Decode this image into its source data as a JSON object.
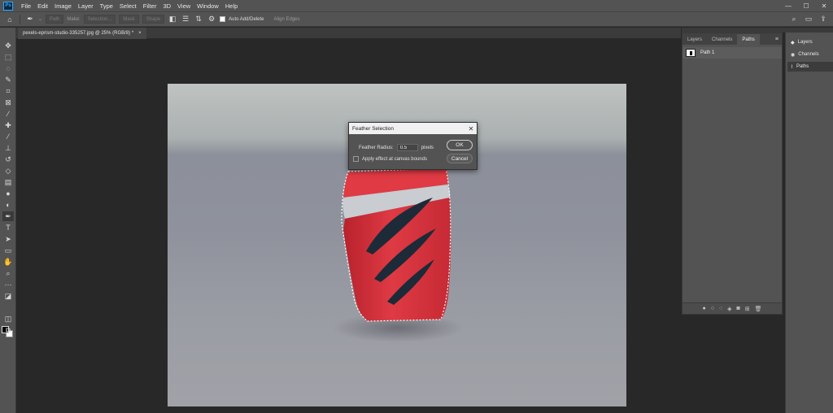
{
  "menubar": {
    "app_logo": "Ps",
    "items": [
      "File",
      "Edit",
      "Image",
      "Layer",
      "Type",
      "Select",
      "Filter",
      "3D",
      "View",
      "Window",
      "Help"
    ],
    "window_controls": [
      "—",
      "☐",
      "✕"
    ]
  },
  "options_bar": {
    "path_mode": "Path",
    "make_label": "Make:",
    "selection_btn": "Selection...",
    "mask_btn": "Mask",
    "shape_btn": "Shape",
    "auto_add_delete_label": "Auto Add/Delete",
    "align_edges_label": "Align Edges"
  },
  "document": {
    "tab_title": "pexels-eprism-studio-335257.jpg @ 25% (RGB/8) *",
    "close_glyph": "×"
  },
  "dialog": {
    "title": "Feather Selection",
    "close_glyph": "✕",
    "radius_label": "Feather Radius:",
    "radius_value": "0.5",
    "radius_unit": "pixels",
    "checkbox_label": "Apply effect at canvas bounds",
    "ok_label": "OK",
    "cancel_label": "Cancel"
  },
  "paths_panel": {
    "tabs": [
      "Layers",
      "Channels",
      "Paths"
    ],
    "active_tab": "Paths",
    "menu_glyph": "≡",
    "path_items": [
      "Path 1"
    ]
  },
  "side_panel": {
    "items": [
      {
        "label": "Layers",
        "icon": "layers-icon"
      },
      {
        "label": "Channels",
        "icon": "channels-icon"
      },
      {
        "label": "Paths",
        "icon": "paths-icon"
      }
    ]
  },
  "colors": {
    "ui_bg": "#535353",
    "canvas_bg": "#282828",
    "object_red": "#d8323c",
    "ps_blue": "#31a8ff"
  }
}
